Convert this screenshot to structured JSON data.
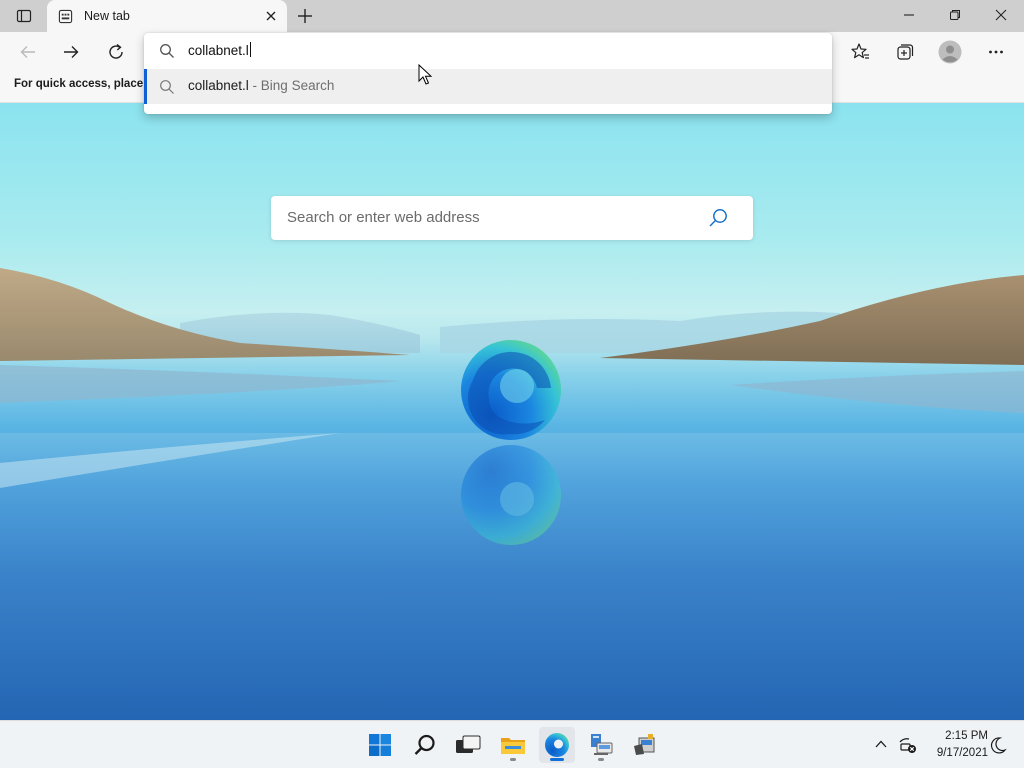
{
  "browser": {
    "tab": {
      "title": "New tab"
    },
    "favorites_bar_text": "For quick access, place y",
    "address": {
      "typed_text": "collabnet.l",
      "suggestion": {
        "query": "collabnet.l",
        "source": " - Bing Search"
      }
    }
  },
  "ntp": {
    "search_placeholder": "Search or enter web address"
  },
  "taskbar": {
    "clock_time": "2:15 PM",
    "clock_date": "9/17/2021",
    "pinned": [
      "start-icon",
      "search-icon",
      "task-view-icon",
      "file-explorer-icon",
      "edge-icon",
      "network-app-icon",
      "setup-app-icon"
    ]
  },
  "colors": {
    "accent": "#0f5fd6",
    "taskbar": "#f0f3f6",
    "chrome": "#f7f7f7"
  }
}
